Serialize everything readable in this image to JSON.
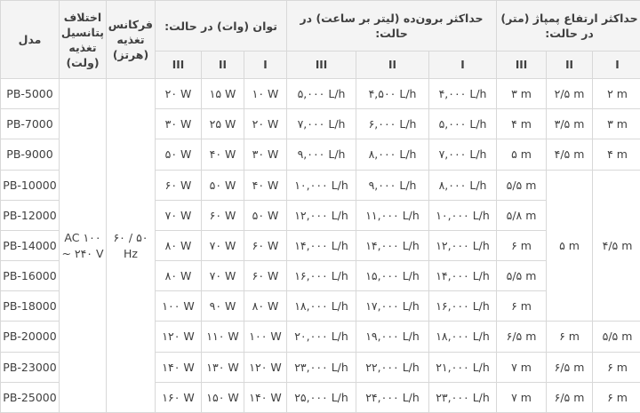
{
  "headers": {
    "height": "حداکثر ارتفاع پمپاژ (متر) در حالت:",
    "flow": "حداکثر برون‌ده (لیتر بر ساعت) در حالت:",
    "power": "توان (وات) در حالت:",
    "frequency": "فرکانس تغذیه (هرتز)",
    "voltage": "اختلاف پتانسیل تغذیه (ولت)",
    "model": "مدل",
    "modes": [
      "I",
      "II",
      "III"
    ]
  },
  "shared": {
    "voltage": "AC ۱۰۰ ~ ۲۴۰ V",
    "frequency": "۵۰ / ۶۰ Hz"
  },
  "height_merged": {
    "h1": "۴/۵ m",
    "h2": "۵ m"
  },
  "rows": [
    {
      "model": "PB-5000",
      "h1": "۲ m",
      "h2": "۲/۵ m",
      "h3": "۳ m",
      "f1": "۴,۰۰۰ L/h",
      "f2": "۴,۵۰۰ L/h",
      "f3": "۵,۰۰۰ L/h",
      "p1": "۱۰ W",
      "p2": "۱۵ W",
      "p3": "۲۰ W"
    },
    {
      "model": "PB-7000",
      "h1": "۳ m",
      "h2": "۳/۵ m",
      "h3": "۴ m",
      "f1": "۵,۰۰۰ L/h",
      "f2": "۶,۰۰۰ L/h",
      "f3": "۷,۰۰۰ L/h",
      "p1": "۲۰ W",
      "p2": "۲۵ W",
      "p3": "۳۰ W"
    },
    {
      "model": "PB-9000",
      "h1": "۴ m",
      "h2": "۴/۵ m",
      "h3": "۵ m",
      "f1": "۷,۰۰۰ L/h",
      "f2": "۸,۰۰۰ L/h",
      "f3": "۹,۰۰۰ L/h",
      "p1": "۳۰ W",
      "p2": "۴۰ W",
      "p3": "۵۰ W"
    },
    {
      "model": "PB-10000",
      "h3": "۵/۵ m",
      "f1": "۸,۰۰۰ L/h",
      "f2": "۹,۰۰۰ L/h",
      "f3": "۱۰,۰۰۰ L/h",
      "p1": "۴۰ W",
      "p2": "۵۰ W",
      "p3": "۶۰ W"
    },
    {
      "model": "PB-12000",
      "h3": "۵/۸ m",
      "f1": "۱۰,۰۰۰ L/h",
      "f2": "۱۱,۰۰۰ L/h",
      "f3": "۱۲,۰۰۰ L/h",
      "p1": "۵۰ W",
      "p2": "۶۰ W",
      "p3": "۷۰ W"
    },
    {
      "model": "PB-14000",
      "h3": "۶ m",
      "f1": "۱۲,۰۰۰ L/h",
      "f2": "۱۴,۰۰۰ L/h",
      "f3": "۱۴,۰۰۰ L/h",
      "p1": "۶۰ W",
      "p2": "۷۰ W",
      "p3": "۸۰ W"
    },
    {
      "model": "PB-16000",
      "h3": "۵/۵ m",
      "f1": "۱۴,۰۰۰ L/h",
      "f2": "۱۵,۰۰۰ L/h",
      "f3": "۱۶,۰۰۰ L/h",
      "p1": "۶۰ W",
      "p2": "۷۰ W",
      "p3": "۸۰ W"
    },
    {
      "model": "PB-18000",
      "h3": "۶ m",
      "f1": "۱۶,۰۰۰ L/h",
      "f2": "۱۷,۰۰۰ L/h",
      "f3": "۱۸,۰۰۰ L/h",
      "p1": "۸۰ W",
      "p2": "۹۰ W",
      "p3": "۱۰۰ W"
    },
    {
      "model": "PB-20000",
      "h1": "۵/۵ m",
      "h2": "۶ m",
      "h3": "۶/۵ m",
      "f1": "۱۸,۰۰۰ L/h",
      "f2": "۱۹,۰۰۰ L/h",
      "f3": "۲۰,۰۰۰ L/h",
      "p1": "۱۰۰ W",
      "p2": "۱۱۰ W",
      "p3": "۱۲۰ W"
    },
    {
      "model": "PB-23000",
      "h1": "۶ m",
      "h2": "۶/۵ m",
      "h3": "۷ m",
      "f1": "۲۱,۰۰۰ L/h",
      "f2": "۲۲,۰۰۰ L/h",
      "f3": "۲۳,۰۰۰ L/h",
      "p1": "۱۲۰ W",
      "p2": "۱۳۰ W",
      "p3": "۱۴۰ W"
    },
    {
      "model": "PB-25000",
      "h1": "۶ m",
      "h2": "۶/۵ m",
      "h3": "۷ m",
      "f1": "۲۳,۰۰۰ L/h",
      "f2": "۲۴,۰۰۰ L/h",
      "f3": "۲۵,۰۰۰ L/h",
      "p1": "۱۴۰ W",
      "p2": "۱۵۰ W",
      "p3": "۱۶۰ W"
    }
  ]
}
